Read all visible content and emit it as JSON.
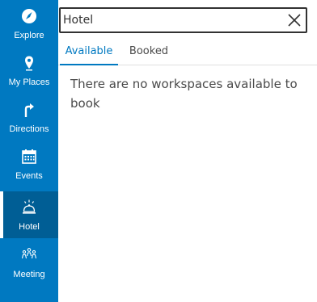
{
  "sidebar": {
    "items": [
      {
        "label": "Explore",
        "icon": "compass-icon",
        "active": false
      },
      {
        "label": "My Places",
        "icon": "map-pin-icon",
        "active": false
      },
      {
        "label": "Directions",
        "icon": "turn-right-arrow-icon",
        "active": false
      },
      {
        "label": "Events",
        "icon": "calendar-icon",
        "active": false
      },
      {
        "label": "Hotel",
        "icon": "service-bell-icon",
        "active": true
      },
      {
        "label": "Meeting",
        "icon": "people-group-icon",
        "active": false
      }
    ]
  },
  "search": {
    "value": "Hotel",
    "clear_icon": "close-icon"
  },
  "tabs": [
    {
      "label": "Available",
      "active": true
    },
    {
      "label": "Booked",
      "active": false
    }
  ],
  "main": {
    "empty_message": "There are no workspaces available to book"
  },
  "colors": {
    "sidebar": "#0079c1",
    "sidebar_active": "#005e95",
    "accent": "#0079c1",
    "text": "#4a4a4a"
  }
}
